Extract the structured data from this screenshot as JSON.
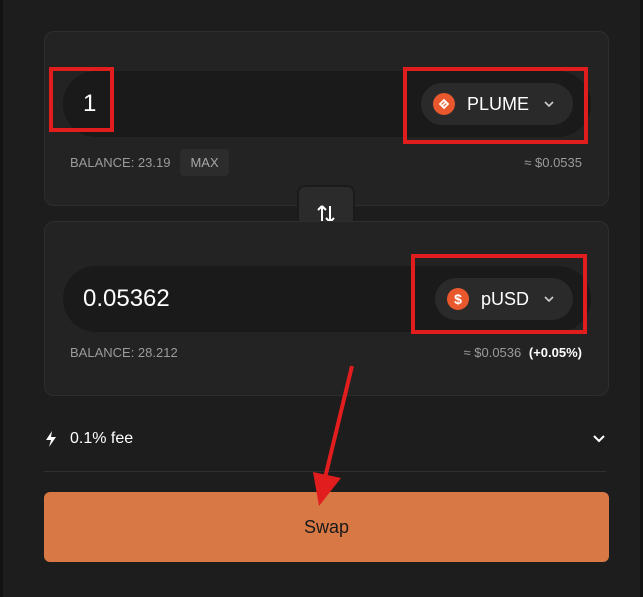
{
  "from": {
    "amount": "1",
    "token": "PLUME",
    "token_icon": "plume-logo-icon",
    "balance_label": "BALANCE: 23.19",
    "max_label": "MAX",
    "usd_value": "≈ $0.0535"
  },
  "to": {
    "amount": "0.05362",
    "token": "pUSD",
    "token_icon": "dollar-coin-icon",
    "balance_label": "BALANCE: 28.212",
    "usd_value": "≈ $0.0536",
    "price_impact": "(+0.05%)"
  },
  "fee": {
    "label": "0.1% fee",
    "icon": "lightning-icon"
  },
  "swap_button_label": "Swap",
  "colors": {
    "accent": "#d87845",
    "token_icon_bg": "#e9582d",
    "annotation": "#e11d1d"
  }
}
